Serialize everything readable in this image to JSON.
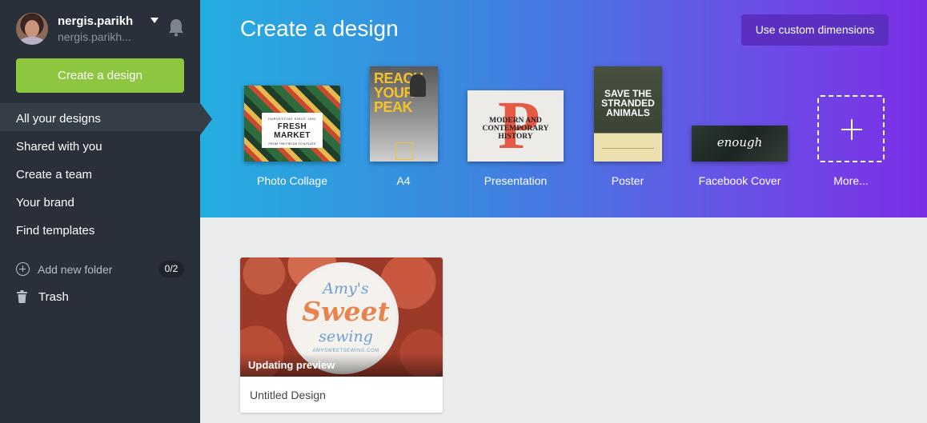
{
  "sidebar": {
    "user": {
      "name": "nergis.parikh",
      "email": "nergis.parikh..."
    },
    "create_button": "Create a design",
    "nav": [
      {
        "label": "All your designs",
        "active": true
      },
      {
        "label": "Shared with you"
      },
      {
        "label": "Create a team"
      },
      {
        "label": "Your brand"
      },
      {
        "label": "Find templates"
      }
    ],
    "add_folder": {
      "label": "Add new folder",
      "count": "0/2"
    },
    "trash": "Trash"
  },
  "banner": {
    "title": "Create a design",
    "custom_button": "Use custom dimensions",
    "tiles": [
      {
        "label": "Photo Collage",
        "thumb_text": [
          "HARVESTING SINCE 1892",
          "FRESH MARKET",
          "FROM THE FIELDS TO A PLATE"
        ]
      },
      {
        "label": "A4",
        "thumb_text": "REACH YOUR PEAK"
      },
      {
        "label": "Presentation",
        "thumb_text": "MODERN AND CONTEMPORARY HISTORY",
        "thumb_letter": "P"
      },
      {
        "label": "Poster",
        "thumb_text": "SAVE THE STRANDED ANIMALS"
      },
      {
        "label": "Facebook Cover",
        "thumb_text": "enough"
      },
      {
        "label": "More..."
      }
    ]
  },
  "designs": [
    {
      "title": "Untitled Design",
      "status": "Updating preview",
      "preview_text": {
        "line1": "Amy's",
        "line2": "Sweet",
        "line3": "sewing",
        "site": "AMYSWEETSEWING.COM"
      }
    }
  ],
  "colors": {
    "sidebar_bg": "#293039",
    "create_button": "#8dc63f",
    "custom_button": "#5b2fbf",
    "banner_start": "#24aee0",
    "banner_end": "#7b2ee6"
  }
}
